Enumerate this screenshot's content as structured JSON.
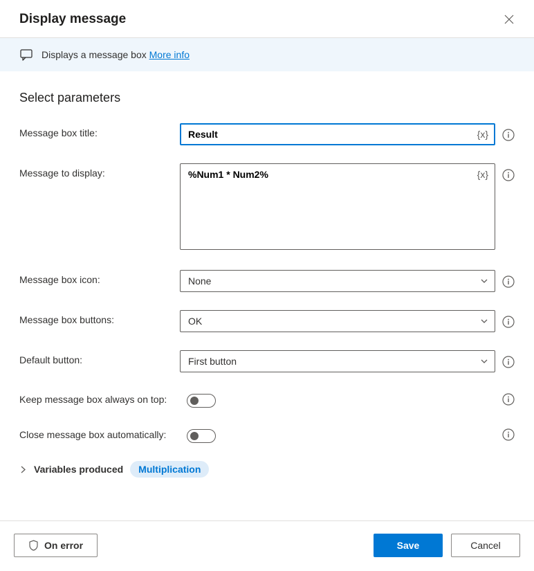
{
  "header": {
    "title": "Display message"
  },
  "banner": {
    "text": "Displays a message box ",
    "link": "More info"
  },
  "section": {
    "title": "Select parameters"
  },
  "fields": {
    "title": {
      "label": "Message box title:",
      "value": "Result",
      "var_token": "{x}"
    },
    "message": {
      "label": "Message to display:",
      "value": "%Num1 * Num2%",
      "var_token": "{x}"
    },
    "icon": {
      "label": "Message box icon:",
      "value": "None"
    },
    "buttons": {
      "label": "Message box buttons:",
      "value": "OK"
    },
    "default_button": {
      "label": "Default button:",
      "value": "First button"
    },
    "always_on_top": {
      "label": "Keep message box always on top:"
    },
    "auto_close": {
      "label": "Close message box automatically:"
    }
  },
  "variables": {
    "label": "Variables produced",
    "badge": "Multiplication"
  },
  "footer": {
    "on_error": "On error",
    "save": "Save",
    "cancel": "Cancel"
  }
}
